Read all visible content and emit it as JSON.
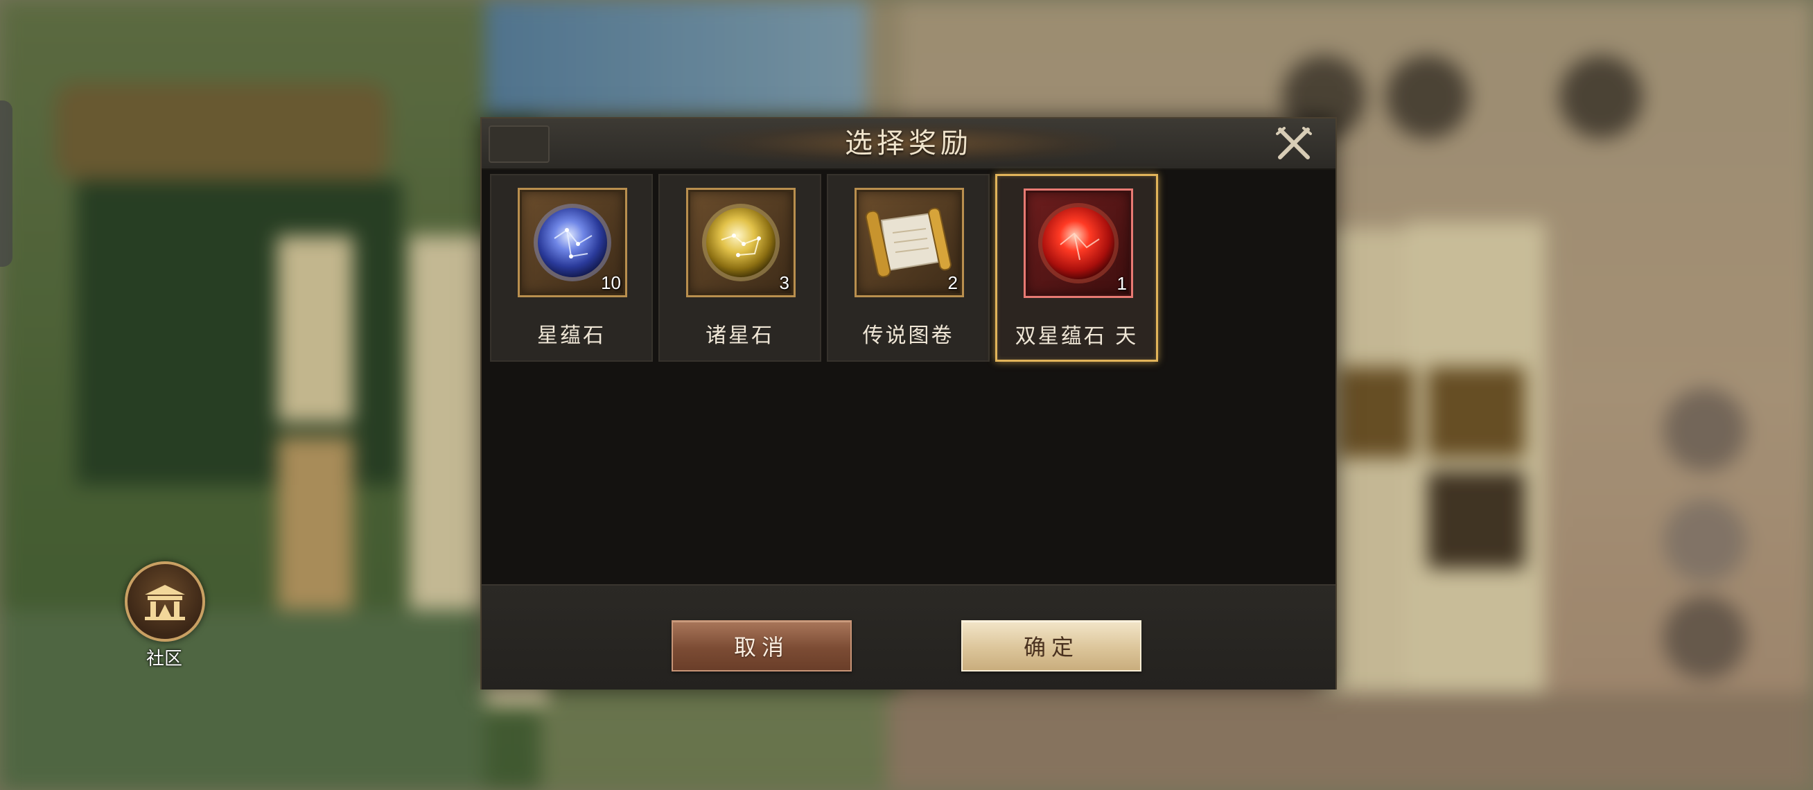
{
  "dialog": {
    "title": "选择奖励",
    "close_icon": "close-crossed-swords-icon",
    "rewards": [
      {
        "name": "星蕴石",
        "count": "10",
        "icon": "blue-star-orb-icon",
        "selected": false
      },
      {
        "name": "诸星石",
        "count": "3",
        "icon": "gold-star-orb-icon",
        "selected": false
      },
      {
        "name": "传说图卷",
        "count": "2",
        "icon": "scroll-icon",
        "selected": false
      },
      {
        "name": "双星蕴石 天",
        "count": "1",
        "icon": "red-star-orb-icon",
        "selected": true
      }
    ],
    "cancel_label": "取消",
    "confirm_label": "确定"
  },
  "community": {
    "label": "社区",
    "icon": "community-pavilion-icon"
  },
  "colors": {
    "dialog_bg": "#141210",
    "slot_bg": "#2a2723",
    "selected_border": "#e2b45a",
    "cancel_button": "#7c4c34",
    "confirm_button": "#dcc59a",
    "title_text": "#f0e4cc"
  }
}
